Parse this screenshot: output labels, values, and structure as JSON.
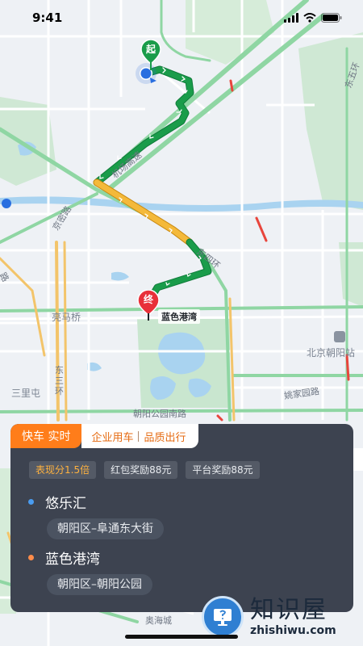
{
  "status_bar": {
    "time": "9:41"
  },
  "map": {
    "labels": {
      "east_ring": "东五环",
      "airport_expressway": "机场高速",
      "jingmi_road": "京密路",
      "east_fourth_ring": "东四环",
      "liangmaqiao": "亮马桥",
      "dongsanhuan": "东三环",
      "sanlitun": "三里屯",
      "beijing_chaoyang_station": "北京朝阳站",
      "yaojiayuan_road": "姚家园路",
      "chaoyang_park_south_road": "朝阳公园南路",
      "aohai_city": "奥海城",
      "luan": "路",
      "third_ring_short": "东三环"
    },
    "start_marker": "起",
    "end_marker": "终",
    "destination_label": "蓝色港湾"
  },
  "card": {
    "tab_active": "快车 实时",
    "tabs": [
      "企业用车",
      "品质出行"
    ],
    "chips": [
      "表现分1.5倍",
      "红包奖励88元",
      "平台奖励88元"
    ],
    "origin": {
      "name": "悠乐汇",
      "address": "朝阳区–阜通东大街"
    },
    "destination": {
      "name": "蓝色港湾",
      "address": "朝阳区–朝阳公园"
    }
  },
  "watermark": {
    "title": "知识屋",
    "url": "zhishiwu.com"
  },
  "colors": {
    "route_green": "#1a9c4a",
    "route_yellow": "#f4b93a",
    "marker_red": "#e8313a",
    "location_blue": "#2a6fe0",
    "accent_orange": "#ff7d1a",
    "card_bg": "#3d4350",
    "origin_dot": "#4a9cf0",
    "destination_dot": "#ff8c4a"
  }
}
